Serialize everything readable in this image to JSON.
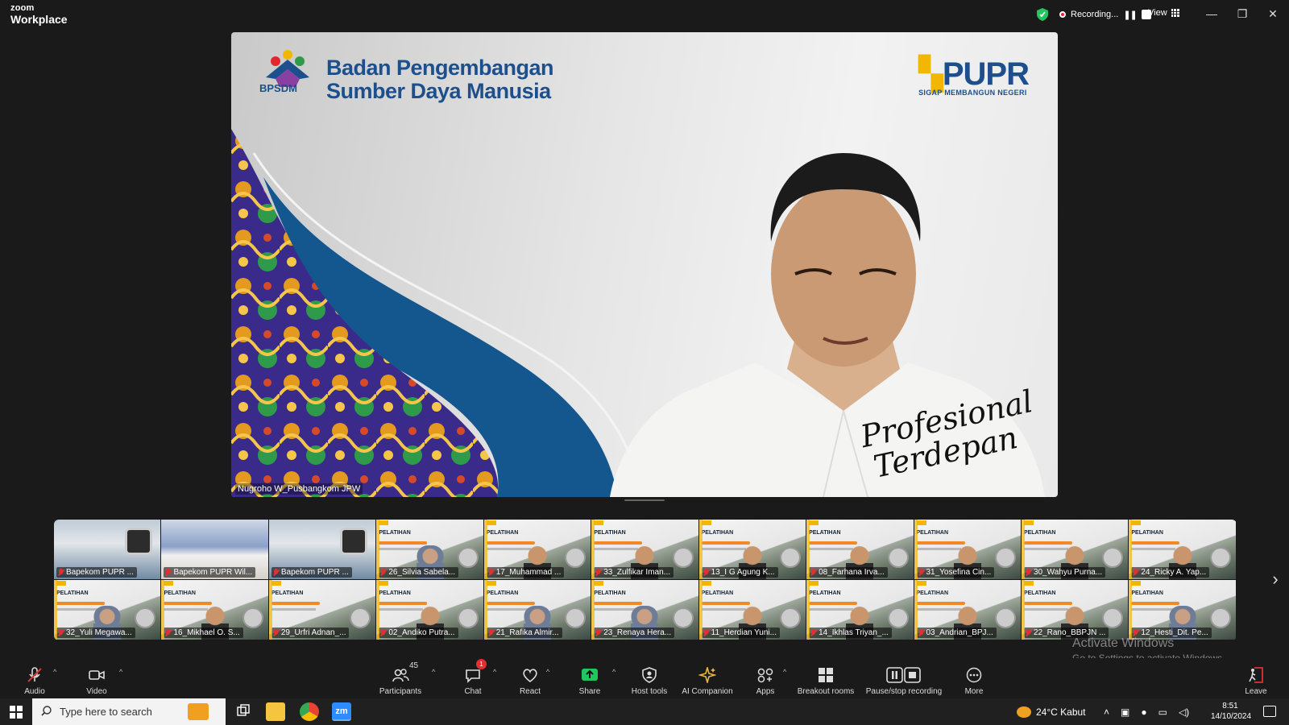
{
  "app": {
    "brand_top": "zoom",
    "brand_bottom": "Workplace"
  },
  "titlebar": {
    "recording_label": "Recording...",
    "view_label": "View"
  },
  "speaker": {
    "org_abbr": "BPSDM",
    "org_title_line1": "Badan Pengembangan",
    "org_title_line2": "Sumber Daya Manusia",
    "ministry_logo": "PUPR",
    "ministry_tagline": "SIGAP MEMBANGUN NEGERI",
    "slogan_line1": "Profesional",
    "slogan_line2": "Terdepan",
    "name": "Nugroho W_Pusbangkom JPW"
  },
  "gallery": {
    "tiles": [
      {
        "name": "Bapekom PUPR ...",
        "style": "room"
      },
      {
        "name": "Bapekom PUPR Wil...",
        "style": "class"
      },
      {
        "name": "Bapekom PUPR ...",
        "style": "room"
      },
      {
        "name": "26_Silvia Sabela...",
        "style": "train",
        "face": "hijab"
      },
      {
        "name": "17_Muhammad ...",
        "style": "train",
        "face": "person"
      },
      {
        "name": "33_Zulfikar Iman...",
        "style": "train",
        "face": "person"
      },
      {
        "name": "13_I G Agung K...",
        "style": "train",
        "face": "person"
      },
      {
        "name": "08_Farhana Irva...",
        "style": "train",
        "face": "person"
      },
      {
        "name": "31_Yosefina Cin...",
        "style": "train",
        "face": "person"
      },
      {
        "name": "30_Wahyu Purna...",
        "style": "train",
        "face": "person"
      },
      {
        "name": "24_Ricky A. Yap...",
        "style": "train",
        "face": "person"
      },
      {
        "name": "32_Yuli Megawa...",
        "style": "train",
        "face": "hijab"
      },
      {
        "name": "16_Mikhael O. S...",
        "style": "train",
        "face": "person"
      },
      {
        "name": "29_Urfri Adnan_...",
        "style": "train",
        "face": "none"
      },
      {
        "name": "02_Andiko Putra...",
        "style": "train",
        "face": "person"
      },
      {
        "name": "21_Rafika Almir...",
        "style": "train",
        "face": "hijab"
      },
      {
        "name": "23_Renaya Hera...",
        "style": "train",
        "face": "hijab"
      },
      {
        "name": "11_Herdian Yuni...",
        "style": "train",
        "face": "person"
      },
      {
        "name": "14_Ikhlas Triyan_...",
        "style": "train",
        "face": "person"
      },
      {
        "name": "03_Andrian_BPJ...",
        "style": "train",
        "face": "person"
      },
      {
        "name": "22_Rano_BBPJN ...",
        "style": "train",
        "face": "person"
      },
      {
        "name": "12_Hesti_Dit. Pe...",
        "style": "train",
        "face": "hijab"
      }
    ],
    "tile_header": "PELATIHAN"
  },
  "watermark": {
    "line1": "Activate Windows",
    "line2": "Go to Settings to activate Windows."
  },
  "toolbar": {
    "audio": "Audio",
    "video": "Video",
    "participants": "Participants",
    "participant_count": "45",
    "chat": "Chat",
    "chat_badge": "1",
    "react": "React",
    "share": "Share",
    "host_tools": "Host tools",
    "ai_companion": "AI Companion",
    "apps": "Apps",
    "breakout": "Breakout rooms",
    "recording": "Pause/stop recording",
    "more": "More",
    "leave": "Leave"
  },
  "taskbar": {
    "search_placeholder": "Type here to search",
    "weather": "24°C  Kabut",
    "time": "8:51",
    "date": "14/10/2024"
  },
  "colors": {
    "brand_blue": "#1d4f8d",
    "brand_yellow": "#f2b705",
    "share_green": "#22c55e",
    "alert_red": "#e03131"
  }
}
